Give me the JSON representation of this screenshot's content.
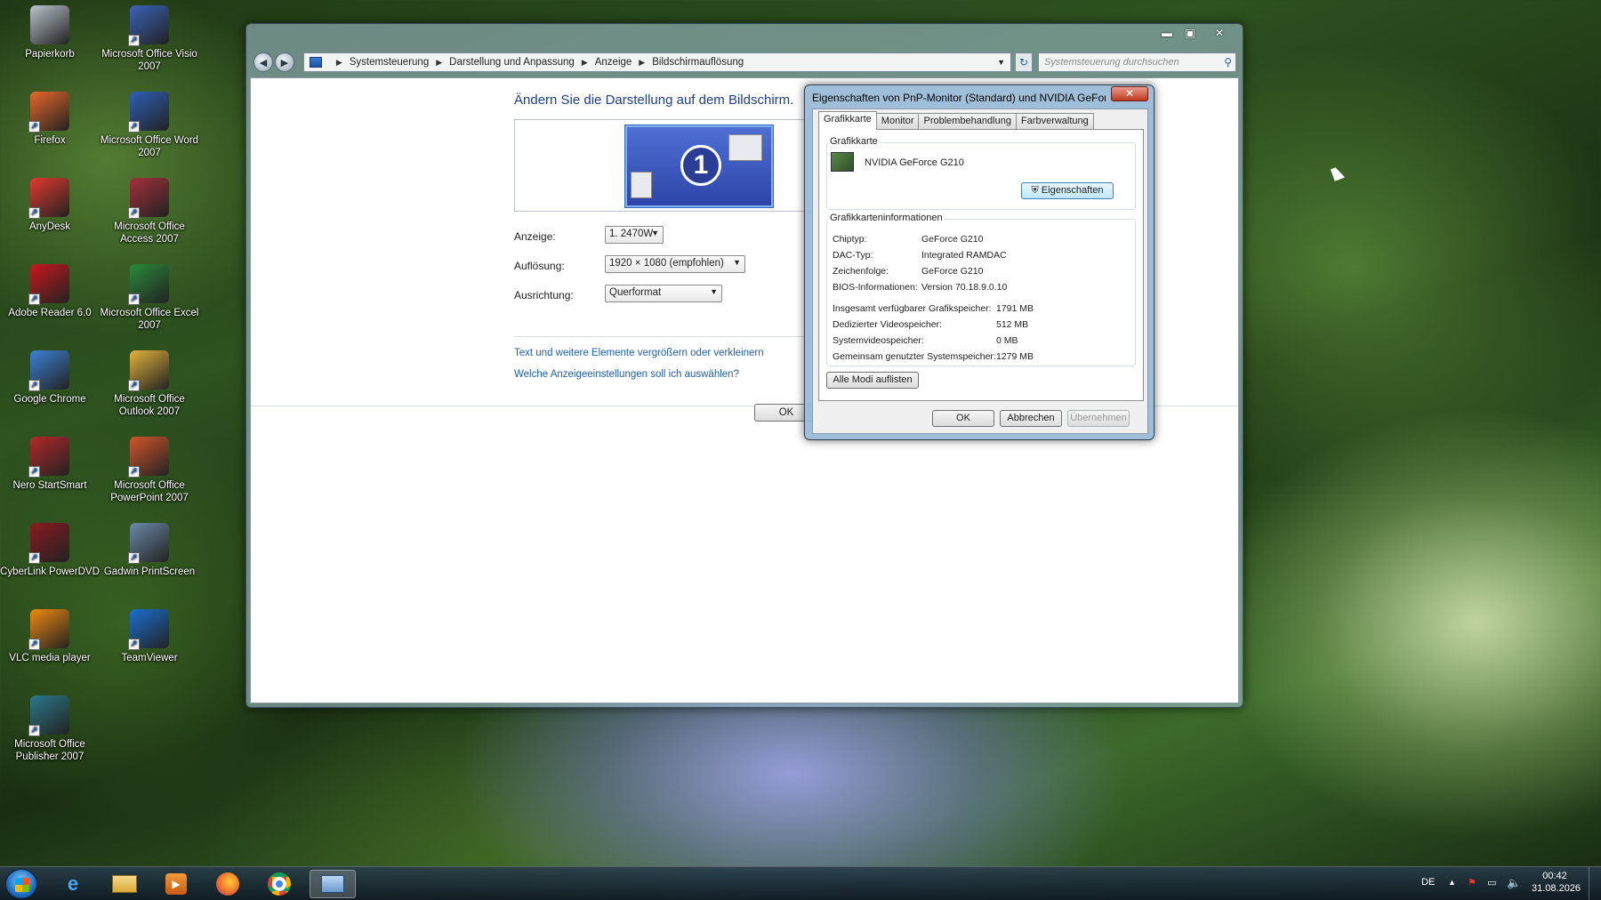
{
  "desktop": {
    "icons": [
      {
        "label": "Papierkorb",
        "icon": "recycle-bin-icon",
        "color": "#b9c4cc"
      },
      {
        "label": "Microsoft Office Visio 2007",
        "icon": "visio-icon",
        "color": "#3a63b8"
      },
      {
        "label": "Firefox",
        "icon": "firefox-icon",
        "color": "#e8682a"
      },
      {
        "label": "Microsoft Office Word 2007",
        "icon": "word-icon",
        "color": "#2d5fb7"
      },
      {
        "label": "AnyDesk",
        "icon": "anydesk-icon",
        "color": "#e2392e"
      },
      {
        "label": "Microsoft Office Access 2007",
        "icon": "access-icon",
        "color": "#a3303a"
      },
      {
        "label": "Adobe Reader 6.0",
        "icon": "adobe-reader-icon",
        "color": "#c8181e"
      },
      {
        "label": "Microsoft Office Excel 2007",
        "icon": "excel-icon",
        "color": "#2a8a3a"
      },
      {
        "label": "Google Chrome",
        "icon": "chrome-icon",
        "color": "#3b82d6"
      },
      {
        "label": "Microsoft Office Outlook 2007",
        "icon": "outlook-icon",
        "color": "#e4b23a"
      },
      {
        "label": "Nero StartSmart",
        "icon": "nero-icon",
        "color": "#b3282a"
      },
      {
        "label": "Microsoft Office PowerPoint 2007",
        "icon": "powerpoint-icon",
        "color": "#d2552a"
      },
      {
        "label": "CyberLink PowerDVD",
        "icon": "powerdvd-icon",
        "color": "#8a1a20"
      },
      {
        "label": "Gadwin PrintScreen",
        "icon": "printscreen-icon",
        "color": "#6a8aa8"
      },
      {
        "label": "VLC media player",
        "icon": "vlc-icon",
        "color": "#f08a10"
      },
      {
        "label": "TeamViewer",
        "icon": "teamviewer-icon",
        "color": "#1a6fd0"
      },
      {
        "label": "Microsoft Office Publisher 2007",
        "icon": "publisher-icon",
        "color": "#2a7a8a"
      }
    ]
  },
  "window": {
    "breadcrumb": [
      "Systemsteuerung",
      "Darstellung und Anpassung",
      "Anzeige",
      "Bildschirmauflösung"
    ],
    "search_placeholder": "Systemsteuerung durchsuchen",
    "heading": "Ändern Sie die Darstellung auf dem Bildschirm.",
    "monitor_number": "1",
    "fields": {
      "display_label": "Anzeige:",
      "display_value": "1. 2470W",
      "resolution_label": "Auflösung:",
      "resolution_value": "1920 × 1080 (empfohlen)",
      "orientation_label": "Ausrichtung:",
      "orientation_value": "Querformat"
    },
    "links": {
      "text_size": "Text und weitere Elemente vergrößern oder verkleinern",
      "which_settings": "Welche Anzeigeeinstellungen soll ich auswählen?"
    },
    "ok_label": "OK"
  },
  "dialog": {
    "title": "Eigenschaften von PnP-Monitor (Standard) und NVIDIA GeForce ...",
    "tabs": [
      "Grafikkarte",
      "Monitor",
      "Problembehandlung",
      "Farbverwaltung"
    ],
    "adapter_group": "Grafikkarte",
    "adapter_name": "NVIDIA GeForce G210",
    "properties_button": "Eigenschaften",
    "info_group": "Grafikkarteninformationen",
    "info": [
      {
        "label": "Chiptyp:",
        "value": "GeForce G210"
      },
      {
        "label": "DAC-Typ:",
        "value": "Integrated RAMDAC"
      },
      {
        "label": "Zeichenfolge:",
        "value": "GeForce G210"
      },
      {
        "label": "BIOS-Informationen:",
        "value": "Version 70.18.9.0.10"
      }
    ],
    "memory": [
      {
        "label": "Insgesamt verfügbarer Grafikspeicher:",
        "value": "1791 MB"
      },
      {
        "label": "Dedizierter Videospeicher:",
        "value": "512 MB"
      },
      {
        "label": "Systemvideospeicher:",
        "value": "0 MB"
      },
      {
        "label": "Gemeinsam genutzter Systemspeicher:",
        "value": "1279 MB"
      }
    ],
    "list_modes_button": "Alle Modi auflisten",
    "ok_button": "OK",
    "cancel_button": "Abbrechen",
    "apply_button": "Übernehmen"
  },
  "taskbar": {
    "language": "DE",
    "time": "00:42",
    "date": "31.08.2026"
  }
}
